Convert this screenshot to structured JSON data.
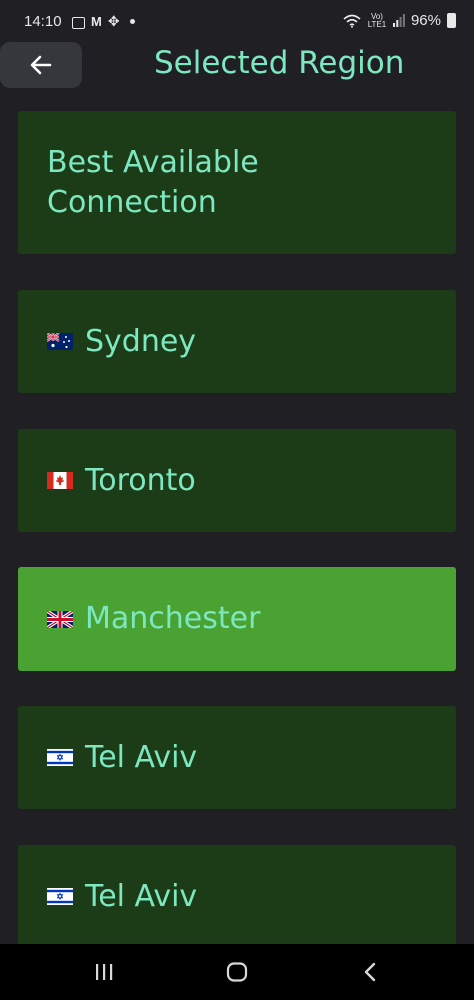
{
  "status_bar": {
    "time": "14:10",
    "lte_label_top": "Vo)",
    "lte_label_bottom": "LTE1",
    "battery": "96%"
  },
  "header": {
    "title": "Selected Region"
  },
  "regions": [
    {
      "label": "Best Available Connection",
      "flag": ""
    },
    {
      "label": "Sydney",
      "flag": "australia-flag"
    },
    {
      "label": "Toronto",
      "flag": "canada-flag"
    },
    {
      "label": "Manchester",
      "flag": "uk-flag",
      "selected": true
    },
    {
      "label": "Tel Aviv",
      "flag": "israel-flag"
    },
    {
      "label": "Tel Aviv",
      "flag": "israel-flag"
    }
  ],
  "colors": {
    "background": "#1f1f24",
    "item": "#1c3c18",
    "item_selected": "#4aa233",
    "text_accent": "#7de8c0"
  },
  "icons": {
    "back": "arrow-left-icon",
    "nav_recents": "recents-icon",
    "nav_home": "home-icon",
    "nav_back": "chevron-left-icon"
  }
}
